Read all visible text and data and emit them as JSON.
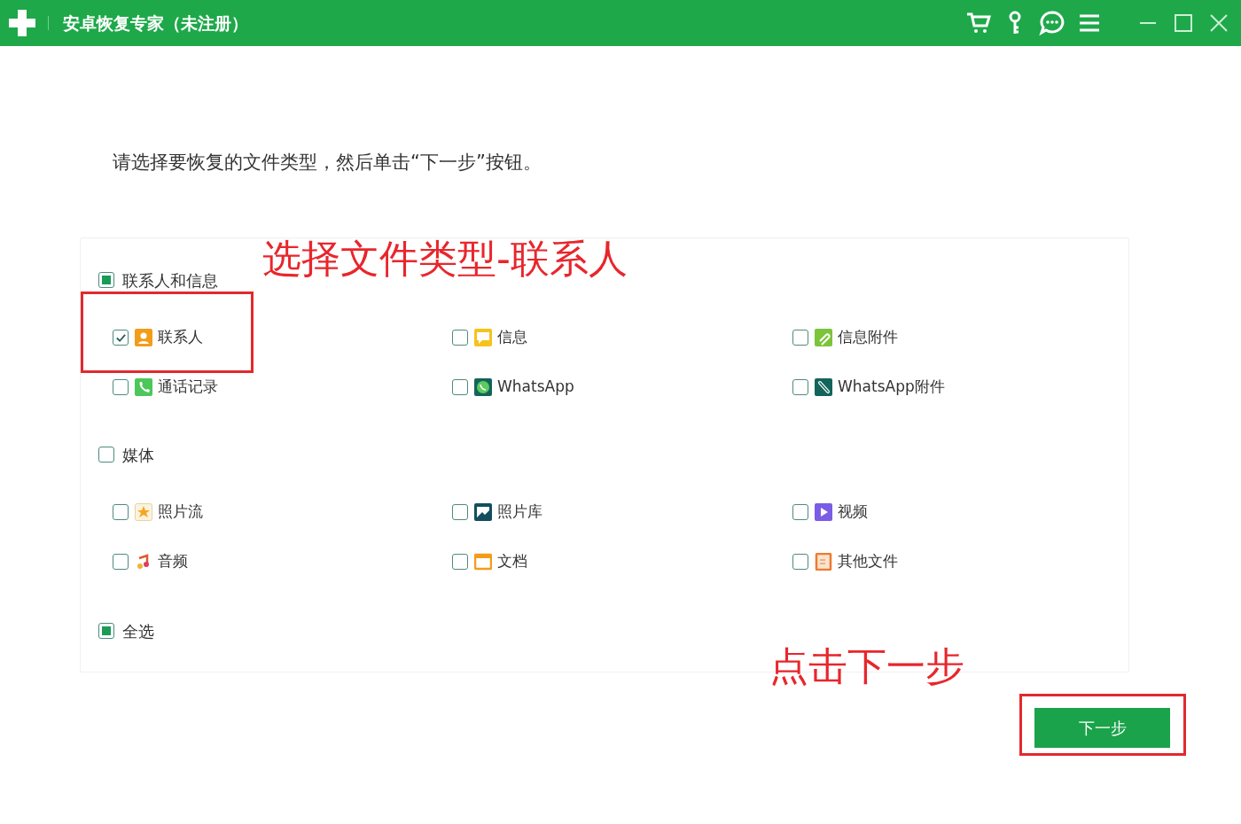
{
  "window": {
    "title": "安卓恢复专家（未注册）"
  },
  "instruction": "请选择要恢复的文件类型，然后单击“下一步”按钮。",
  "groups": [
    {
      "label": "联系人和信息",
      "checked": false,
      "partial": true,
      "items": [
        {
          "label": "联系人",
          "checked": true,
          "kind": "contact"
        },
        {
          "label": "信息",
          "checked": false,
          "kind": "message"
        },
        {
          "label": "信息附件",
          "checked": false,
          "kind": "attachment"
        },
        {
          "label": "通话记录",
          "checked": false,
          "kind": "phone"
        },
        {
          "label": "WhatsApp",
          "checked": false,
          "kind": "whatsapp"
        },
        {
          "label": "WhatsApp附件",
          "checked": false,
          "kind": "whatsapp-attachment"
        }
      ]
    },
    {
      "label": "媒体",
      "checked": false,
      "partial": false,
      "items": [
        {
          "label": "照片流",
          "checked": false,
          "kind": "photostream"
        },
        {
          "label": "照片库",
          "checked": false,
          "kind": "gallery"
        },
        {
          "label": "视频",
          "checked": false,
          "kind": "video"
        },
        {
          "label": "音频",
          "checked": false,
          "kind": "audio"
        },
        {
          "label": "文档",
          "checked": false,
          "kind": "document"
        },
        {
          "label": "其他文件",
          "checked": false,
          "kind": "file"
        }
      ]
    }
  ],
  "select_all": {
    "label": "全选",
    "checked": false,
    "partial": true
  },
  "next_button": "下一步",
  "annotations": [
    {
      "text": "选择文件类型-联系人"
    },
    {
      "text": "点击下一步"
    }
  ]
}
